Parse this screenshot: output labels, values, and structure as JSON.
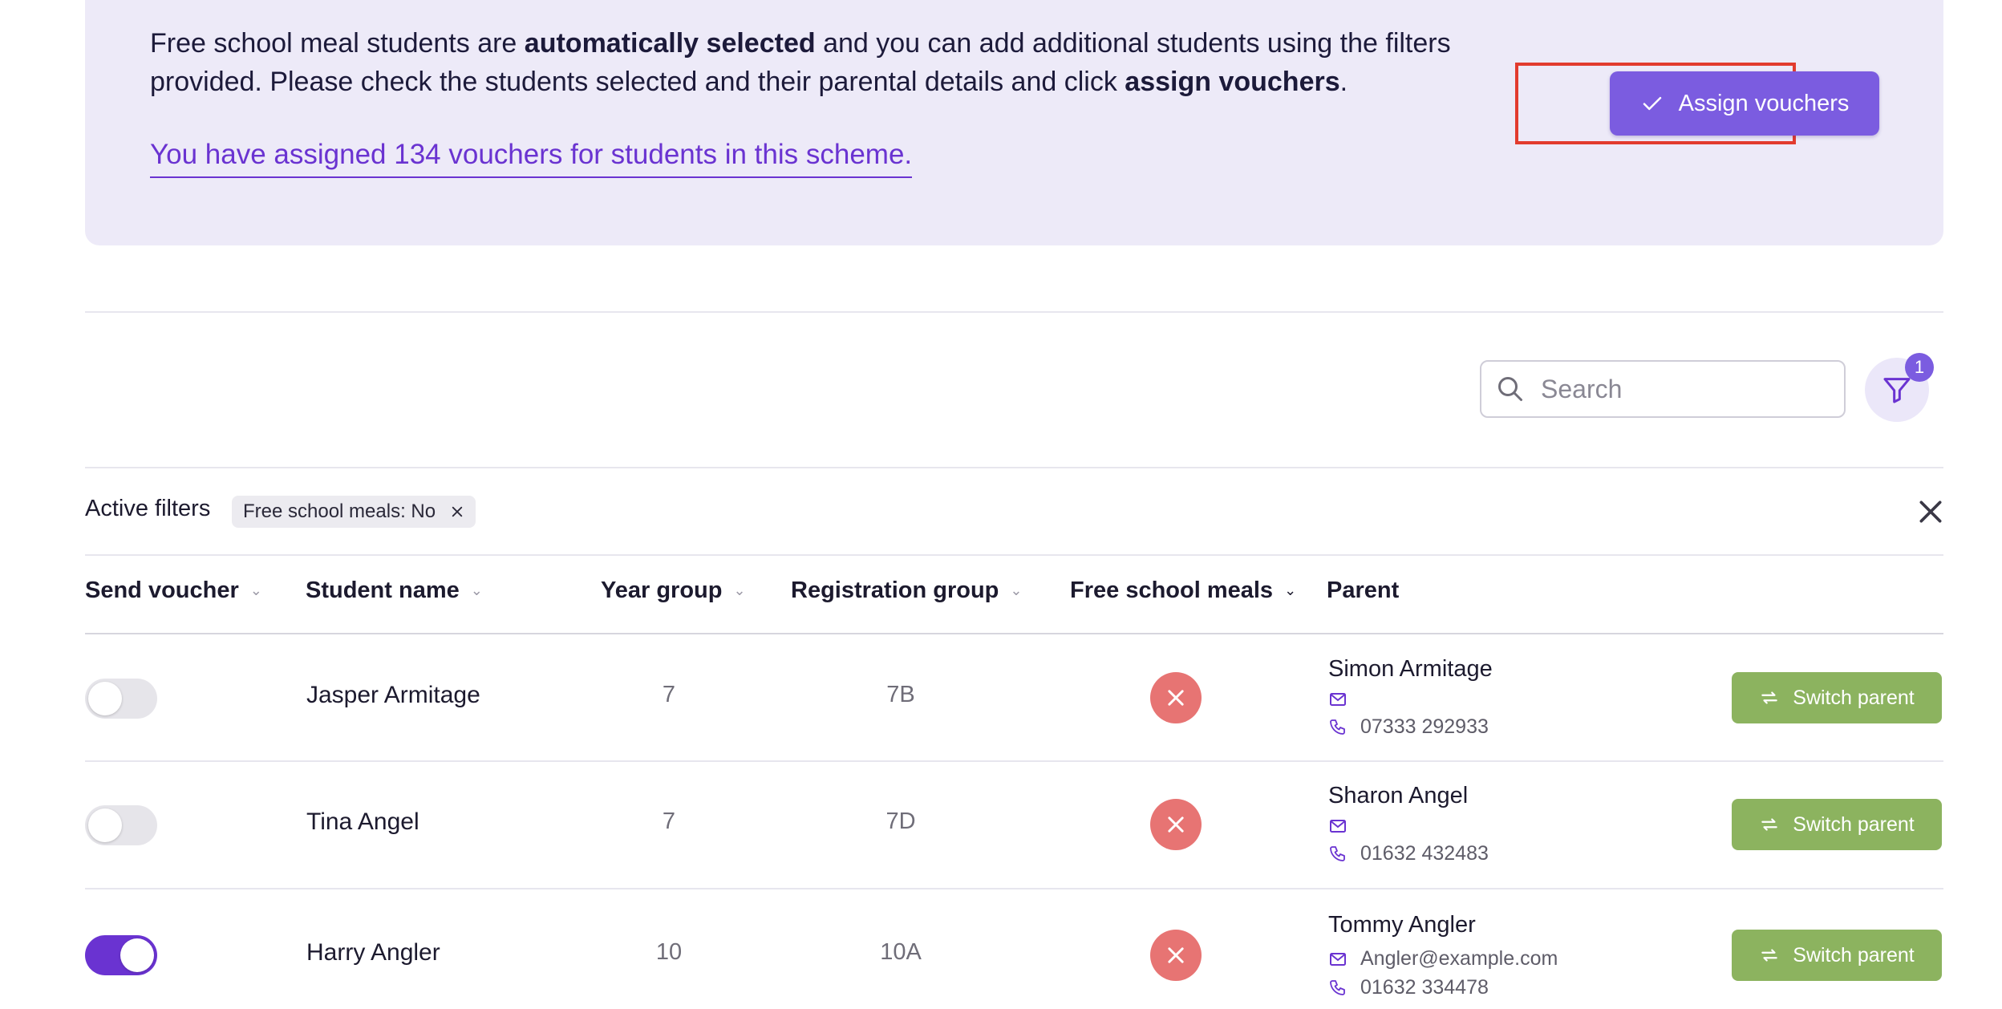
{
  "banner": {
    "text_1": "Free school meal students are ",
    "text_bold_1": "automatically selected",
    "text_2": " and you can add additional students using the filters provided. Please check the students selected and their parental details and click ",
    "text_bold_2": "assign vouchers",
    "text_3": ".",
    "assigned_link": "You have assigned 134 vouchers for students in this scheme.",
    "assign_button": "Assign vouchers"
  },
  "toolbar": {
    "search_placeholder": "Search",
    "filter_badge_count": "1"
  },
  "filters": {
    "label": "Active filters",
    "chips": [
      "Free school meals: No"
    ]
  },
  "table": {
    "headers": [
      "Send voucher",
      "Student name",
      "Year group",
      "Registration group",
      "Free school meals",
      "Parent"
    ],
    "switch_label": "Switch parent",
    "rows": [
      {
        "send_voucher": false,
        "student": "Jasper Armitage",
        "year": "7",
        "reg": "7B",
        "fsm": false,
        "parent": "Simon Armitage",
        "email": "",
        "phone": "07333 292933"
      },
      {
        "send_voucher": false,
        "student": "Tina Angel",
        "year": "7",
        "reg": "7D",
        "fsm": false,
        "parent": "Sharon Angel",
        "email": "",
        "phone": "01632 432483"
      },
      {
        "send_voucher": true,
        "student": "Harry Angler",
        "year": "10",
        "reg": "10A",
        "fsm": false,
        "parent": "Tommy Angler",
        "email": "Angler@example.com",
        "phone": "01632 334478"
      }
    ]
  },
  "colors": {
    "accent": "#7b5ce0",
    "banner_bg": "#edeaf8",
    "fsm_no": "#e77473",
    "switch_button": "#8cb35f",
    "highlight": "#e23b2e"
  },
  "icons": [
    "check-icon",
    "search-icon",
    "filter-icon",
    "close-icon",
    "chevron-down-icon",
    "x-circle-icon",
    "mail-icon",
    "phone-icon",
    "switch-icon"
  ]
}
